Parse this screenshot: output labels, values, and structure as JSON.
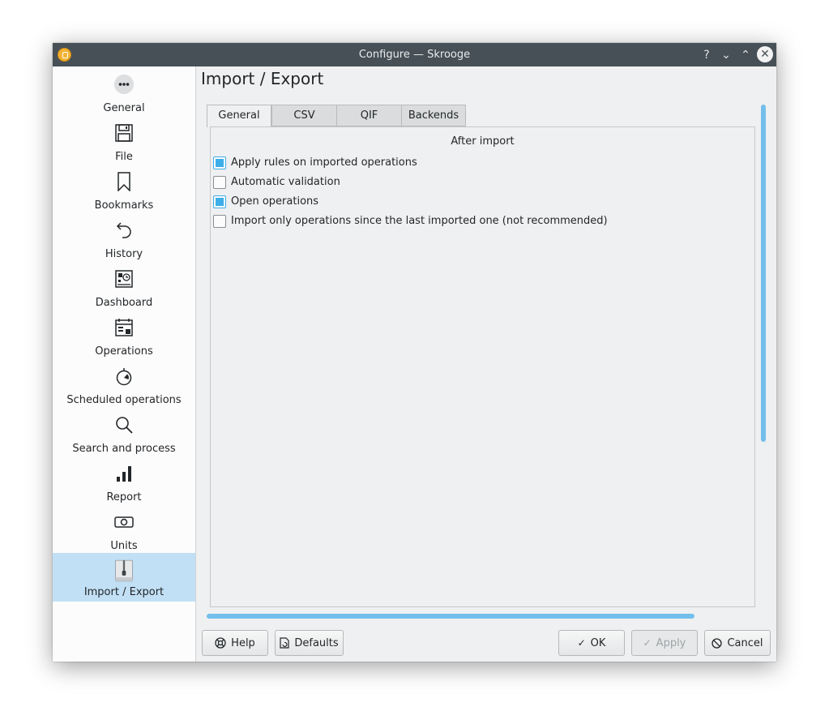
{
  "window": {
    "title": "Configure — Skrooge",
    "controls": {
      "help": "?",
      "minimize": "⌄",
      "maximize": "⌃",
      "close": "✕"
    }
  },
  "sidebar": {
    "items": [
      {
        "label": "General",
        "icon": "more-icon"
      },
      {
        "label": "File",
        "icon": "floppy-icon"
      },
      {
        "label": "Bookmarks",
        "icon": "bookmark-icon"
      },
      {
        "label": "History",
        "icon": "undo-icon"
      },
      {
        "label": "Dashboard",
        "icon": "dashboard-icon"
      },
      {
        "label": "Operations",
        "icon": "calendar-grid-icon"
      },
      {
        "label": "Scheduled operations",
        "icon": "stopwatch-icon"
      },
      {
        "label": "Search and process",
        "icon": "search-icon"
      },
      {
        "label": "Report",
        "icon": "bar-chart-icon"
      },
      {
        "label": "Units",
        "icon": "money-icon"
      },
      {
        "label": "Import / Export",
        "icon": "archive-icon",
        "active": true
      }
    ]
  },
  "page": {
    "title": "Import / Export"
  },
  "tabs": [
    {
      "label": "General",
      "active": true
    },
    {
      "label": "CSV"
    },
    {
      "label": "QIF"
    },
    {
      "label": "Backends"
    }
  ],
  "general_tab": {
    "section_title": "After import",
    "options": [
      {
        "label": "Apply rules on imported operations",
        "checked": true
      },
      {
        "label": "Automatic validation",
        "checked": false
      },
      {
        "label": "Open operations",
        "checked": true
      },
      {
        "label": "Import only operations since the last imported one (not recommended)",
        "checked": false
      }
    ]
  },
  "buttons": {
    "help": "Help",
    "defaults": "Defaults",
    "ok": "OK",
    "apply": "Apply",
    "cancel": "Cancel"
  },
  "colors": {
    "accent": "#3daee9",
    "selection": "#c2e0f5",
    "titlebar": "#475057"
  }
}
